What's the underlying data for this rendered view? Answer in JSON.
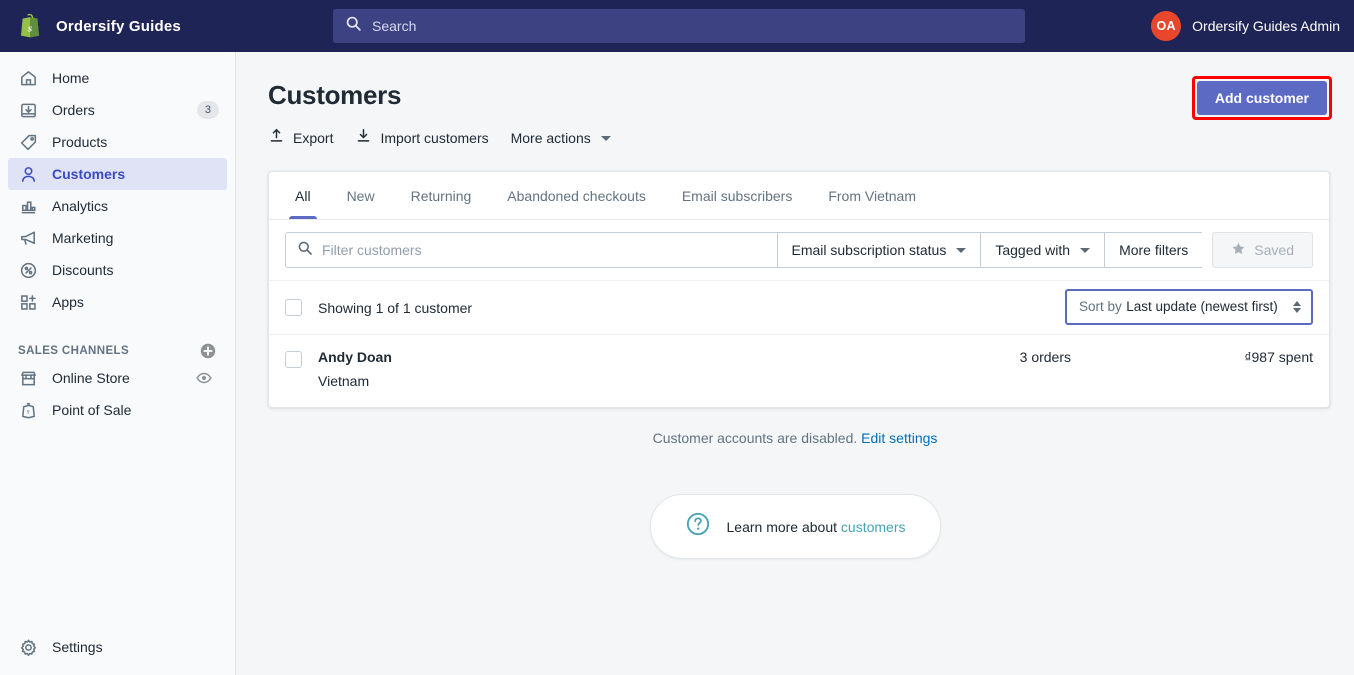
{
  "topbar": {
    "brand_name": "Ordersify Guides",
    "brand_icon": "shopify-bag-icon",
    "search": {
      "icon": "search-icon",
      "placeholder": "Search",
      "value": ""
    },
    "user": {
      "initials": "OA",
      "name": "Ordersify Guides Admin",
      "avatar_color": "#e8472b"
    }
  },
  "sidebar": {
    "items": [
      {
        "label": "Home",
        "icon": "home-icon",
        "badge": "",
        "active": false
      },
      {
        "label": "Orders",
        "icon": "orders-inbox-icon",
        "badge": "3",
        "active": false
      },
      {
        "label": "Products",
        "icon": "products-tag-icon",
        "badge": "",
        "active": false
      },
      {
        "label": "Customers",
        "icon": "customers-person-icon",
        "badge": "",
        "active": true
      },
      {
        "label": "Analytics",
        "icon": "analytics-bars-icon",
        "badge": "",
        "active": false
      },
      {
        "label": "Marketing",
        "icon": "marketing-megaphone-icon",
        "badge": "",
        "active": false
      },
      {
        "label": "Discounts",
        "icon": "discounts-percent-icon",
        "badge": "",
        "active": false
      },
      {
        "label": "Apps",
        "icon": "apps-grid-icon",
        "badge": "",
        "active": false
      }
    ],
    "sales_channels": {
      "title": "SALES CHANNELS",
      "add_icon": "plus-circle-icon",
      "items": [
        {
          "label": "Online Store",
          "icon": "online-store-icon",
          "trailing_icon": "eye-icon"
        },
        {
          "label": "Point of Sale",
          "icon": "point-of-sale-icon",
          "trailing_icon": ""
        }
      ]
    },
    "settings": {
      "label": "Settings",
      "icon": "gear-icon"
    }
  },
  "page": {
    "title": "Customers",
    "actions": [
      {
        "label": "Export",
        "icon": "export-upload-icon"
      },
      {
        "label": "Import customers",
        "icon": "import-download-icon"
      },
      {
        "label": "More actions",
        "icon": "chevron-down-icon"
      }
    ],
    "primary_button": {
      "label": "Add customer",
      "color": "#5c6ac4",
      "highlight_color": "#ff0000"
    }
  },
  "tabs": [
    {
      "label": "All",
      "active": true
    },
    {
      "label": "New",
      "active": false
    },
    {
      "label": "Returning",
      "active": false
    },
    {
      "label": "Abandoned checkouts",
      "active": false
    },
    {
      "label": "Email subscribers",
      "active": false
    },
    {
      "label": "From Vietnam",
      "active": false
    }
  ],
  "filters": {
    "search": {
      "icon": "search-icon",
      "placeholder": "Filter customers",
      "value": ""
    },
    "buttons": [
      {
        "label": "Email subscription status",
        "has_caret": true
      },
      {
        "label": "Tagged with",
        "has_caret": true
      },
      {
        "label": "More filters",
        "has_caret": false
      }
    ],
    "saved": {
      "label": "Saved",
      "icon": "star-icon",
      "disabled": true
    }
  },
  "list": {
    "showing_text": "Showing 1 of 1 customer",
    "sort": {
      "prefix": "Sort by",
      "value": "Last update (newest first)",
      "icon": "stepper-icon"
    },
    "rows": [
      {
        "name": "Andy Doan",
        "location": "Vietnam",
        "orders": "3 orders",
        "spent": "₫987 spent"
      }
    ]
  },
  "footer": {
    "note_text": "Customer accounts are disabled.",
    "note_link": "Edit settings",
    "learn": {
      "icon": "question-circle-icon",
      "text": "Learn more about",
      "link": "customers"
    }
  }
}
